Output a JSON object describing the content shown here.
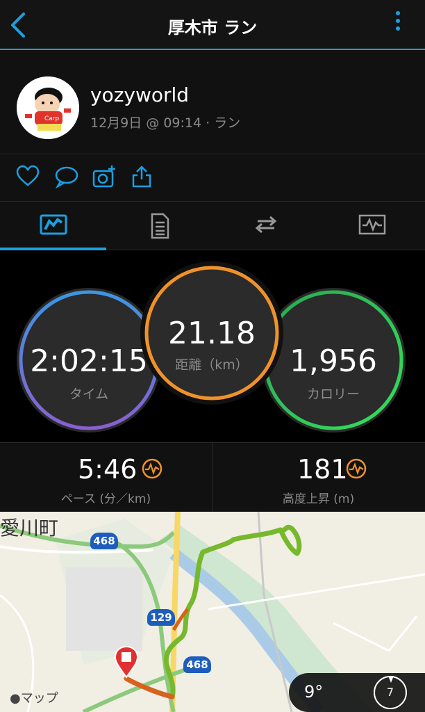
{
  "nav": {
    "title": "厚木市 ラン"
  },
  "profile": {
    "username": "yozyworld",
    "subline": "12月9日 @ 09:14 · ラン"
  },
  "stats": {
    "time": {
      "value": "2:02:15",
      "label": "タイム"
    },
    "distance": {
      "value": "21.18",
      "label": "距離（km）"
    },
    "calories": {
      "value": "1,956",
      "label": "カロリー"
    }
  },
  "metrics": {
    "pace": {
      "value": "5:46",
      "label": "ペース (分／km)"
    },
    "elevation": {
      "value": "181",
      "label": "高度上昇 (m)"
    }
  },
  "map": {
    "place_label": "愛川町",
    "route_badges": [
      "468",
      "129",
      "468"
    ],
    "attribution": "マップ",
    "temperature": "9°",
    "compass_value": "7"
  },
  "colors": {
    "accent": "#1ba0e1",
    "time_ring": "#6f6fe0",
    "distance_ring": "#f0922a",
    "calories_ring": "#2ecc55",
    "track": "#77b82d",
    "icon_orange": "#f0922a"
  },
  "icons": [
    "back-arrow-icon",
    "more-vertical-icon",
    "heart-icon",
    "comment-icon",
    "camera-add-icon",
    "share-icon",
    "stats-tab-icon",
    "splits-tab-icon",
    "laps-tab-icon",
    "chart-tab-icon",
    "pace-chart-icon",
    "elevation-chart-icon",
    "stop-marker-icon",
    "compass-icon"
  ]
}
